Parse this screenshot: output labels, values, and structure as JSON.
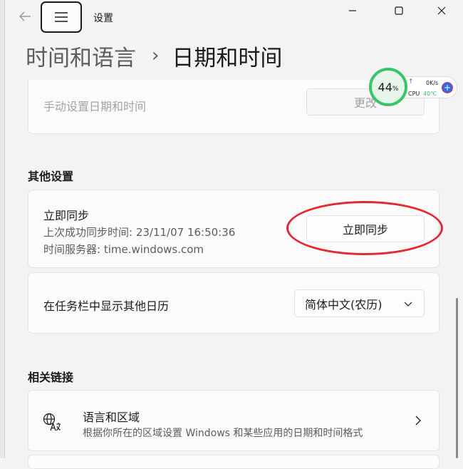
{
  "window": {
    "title": "设置",
    "controls": {
      "minimize_icon": "minimize-icon",
      "maximize_icon": "maximize-icon",
      "close_icon": "close-icon"
    }
  },
  "breadcrumb": {
    "parent": "时间和语言",
    "separator": "›",
    "current": "日期和时间"
  },
  "manual_time": {
    "label": "手动设置日期和时间",
    "button_label": "更改"
  },
  "other_settings": {
    "heading": "其他设置",
    "sync": {
      "title": "立即同步",
      "last_sync": "上次成功同步时间: 23/11/07 16:50:36",
      "server": "时间服务器: time.windows.com",
      "button_label": "立即同步"
    },
    "taskbar_calendar": {
      "label": "在任务栏中显示其他日历",
      "selected": "简体中文(农历)"
    }
  },
  "related_links": {
    "heading": "相关链接",
    "language_region": {
      "title": "语言和区域",
      "description": "根据你所在的区域设置 Windows 和某些应用的日期和时间格式"
    }
  },
  "monitor_widget": {
    "usage_value": "44",
    "usage_unit": "%",
    "net_speed": "0K/s",
    "cpu_label": "CPU",
    "cpu_temp": "40℃",
    "plus": "+"
  },
  "colors": {
    "accent_red": "#e8262f",
    "gauge_green": "#38c46a",
    "plus_blue": "#2d6be8"
  }
}
